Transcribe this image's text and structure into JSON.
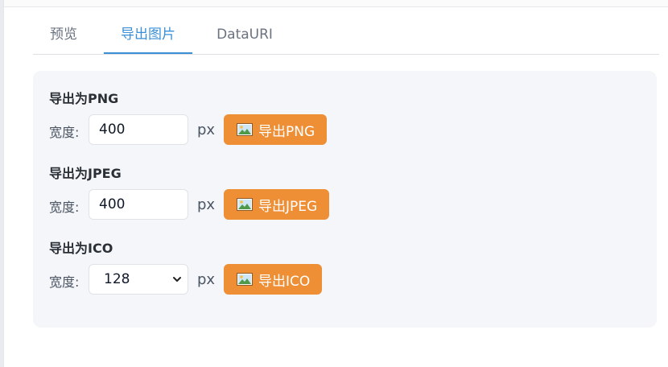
{
  "tabs": [
    {
      "label": "预览"
    },
    {
      "label": "导出图片",
      "active": true
    },
    {
      "label": "DataURI"
    }
  ],
  "colors": {
    "accent": "#3a8fd6",
    "button": "#ee8e35",
    "panel_bg": "#f4f6f9"
  },
  "sections": [
    {
      "title": "导出为PNG",
      "width_label": "宽度:",
      "width_value": "400",
      "unit": "px",
      "button_label": "导出PNG",
      "button_icon": "picture-icon"
    },
    {
      "title": "导出为JPEG",
      "width_label": "宽度:",
      "width_value": "400",
      "unit": "px",
      "button_label": "导出JPEG",
      "button_icon": "picture-icon"
    },
    {
      "title": "导出为ICO",
      "width_label": "宽度:",
      "width_value": "128",
      "unit": "px",
      "button_label": "导出ICO",
      "button_icon": "picture-icon"
    }
  ]
}
